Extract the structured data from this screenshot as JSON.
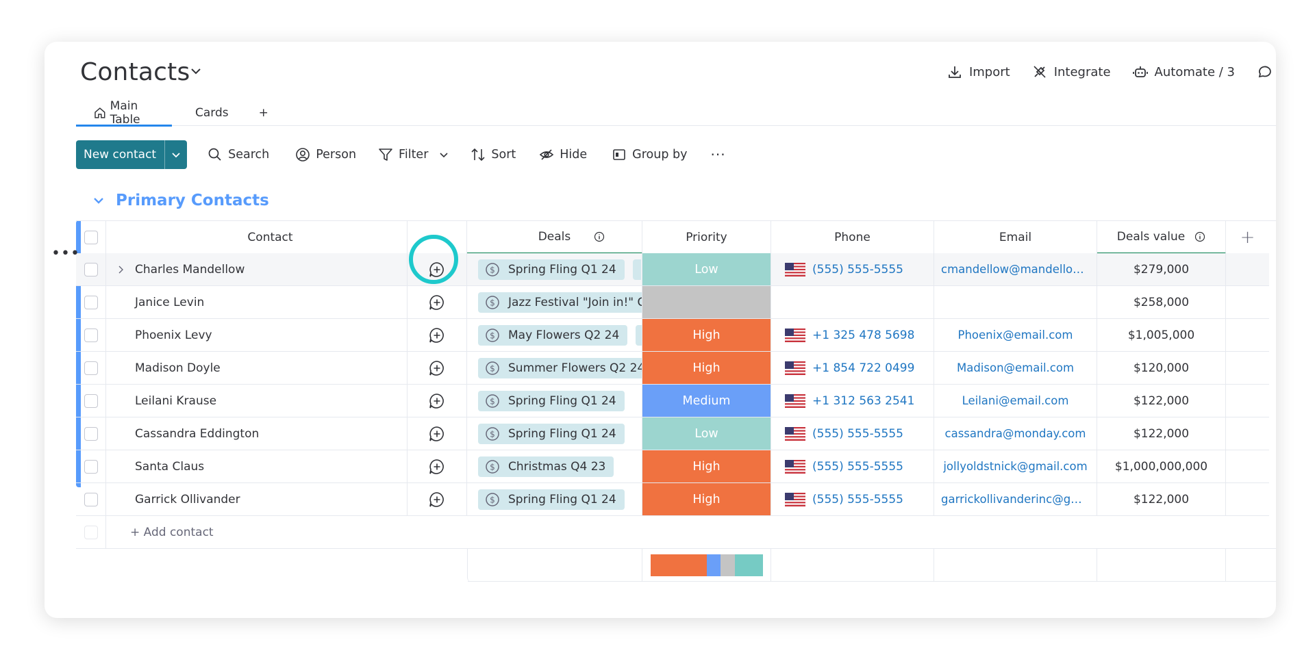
{
  "header": {
    "title": "Contacts",
    "actions": [
      {
        "label": "Import",
        "icon": "download-icon"
      },
      {
        "label": "Integrate",
        "icon": "plug-icon"
      },
      {
        "label": "Automate / 3",
        "icon": "robot-icon"
      },
      {
        "label": "",
        "icon": "chat-bubble-icon"
      }
    ]
  },
  "tabs": [
    {
      "label": "Main Table",
      "icon": "home-icon",
      "active": true
    },
    {
      "label": "Cards"
    },
    {
      "label": "+"
    }
  ],
  "toolbar": {
    "new_label": "New contact",
    "search": "Search",
    "person": "Person",
    "filter": "Filter",
    "sort": "Sort",
    "hide": "Hide",
    "group_by": "Group by",
    "more": "···"
  },
  "group": {
    "title": "Primary Contacts",
    "color": "#579bfc"
  },
  "columns": {
    "contact": "Contact",
    "deals": "Deals",
    "priority": "Priority",
    "phone": "Phone",
    "email": "Email",
    "deals_value": "Deals value",
    "add": "+"
  },
  "rows": [
    {
      "name": "Charles Mandellow",
      "deal": "Spring Fling Q1 24",
      "more": true,
      "priority": "Low",
      "phone": "(555) 555-5555",
      "email": "cmandellow@mandellow....",
      "value": "$279,000"
    },
    {
      "name": "Janice Levin",
      "deal": "Jazz Festival \"Join in!\" C",
      "more": false,
      "priority": "",
      "phone": "",
      "email": "",
      "value": "$258,000"
    },
    {
      "name": "Phoenix Levy",
      "deal": "May Flowers Q2 24",
      "more": true,
      "priority": "High",
      "phone": "+1 325 478 5698",
      "email": "Phoenix@email.com",
      "value": "$1,005,000"
    },
    {
      "name": "Madison Doyle",
      "deal": "Summer Flowers Q2 24",
      "more": false,
      "priority": "High",
      "phone": "+1 854 722 0499",
      "email": "Madison@email.com",
      "value": "$120,000"
    },
    {
      "name": "Leilani Krause",
      "deal": "Spring Fling Q1 24",
      "more": false,
      "priority": "Medium",
      "phone": "+1 312 563 2541",
      "email": "Leilani@email.com",
      "value": "$122,000"
    },
    {
      "name": "Cassandra Eddington",
      "deal": "Spring Fling Q1 24",
      "more": false,
      "priority": "Low",
      "phone": "(555) 555-5555",
      "email": "cassandra@monday.com",
      "value": "$122,000"
    },
    {
      "name": "Santa Claus",
      "deal": "Christmas Q4 23",
      "more": false,
      "priority": "High",
      "phone": "(555) 555-5555",
      "email": "jollyoldstnick@gmail.com",
      "value": "$1,000,000,000"
    },
    {
      "name": "Garrick Ollivander",
      "deal": "Spring Fling Q1 24",
      "more": false,
      "priority": "High",
      "phone": "(555) 555-5555",
      "email": "garrickollivanderinc@gm...",
      "value": "$122,000"
    }
  ],
  "add_row_label": "+ Add contact",
  "priority_colors": {
    "Low": "#9cd5cf",
    "High": "#f07240",
    "Medium": "#6a9ff8",
    "": "#c4c4c4"
  },
  "priority_summary": [
    {
      "label": "High",
      "fraction": 0.5,
      "color": "#f07240"
    },
    {
      "label": "Medium",
      "fraction": 0.125,
      "color": "#6a9ff8"
    },
    {
      "label": "Empty",
      "fraction": 0.125,
      "color": "#c4c4c4"
    },
    {
      "label": "Low",
      "fraction": 0.25,
      "color": "#76cbc4"
    }
  ]
}
